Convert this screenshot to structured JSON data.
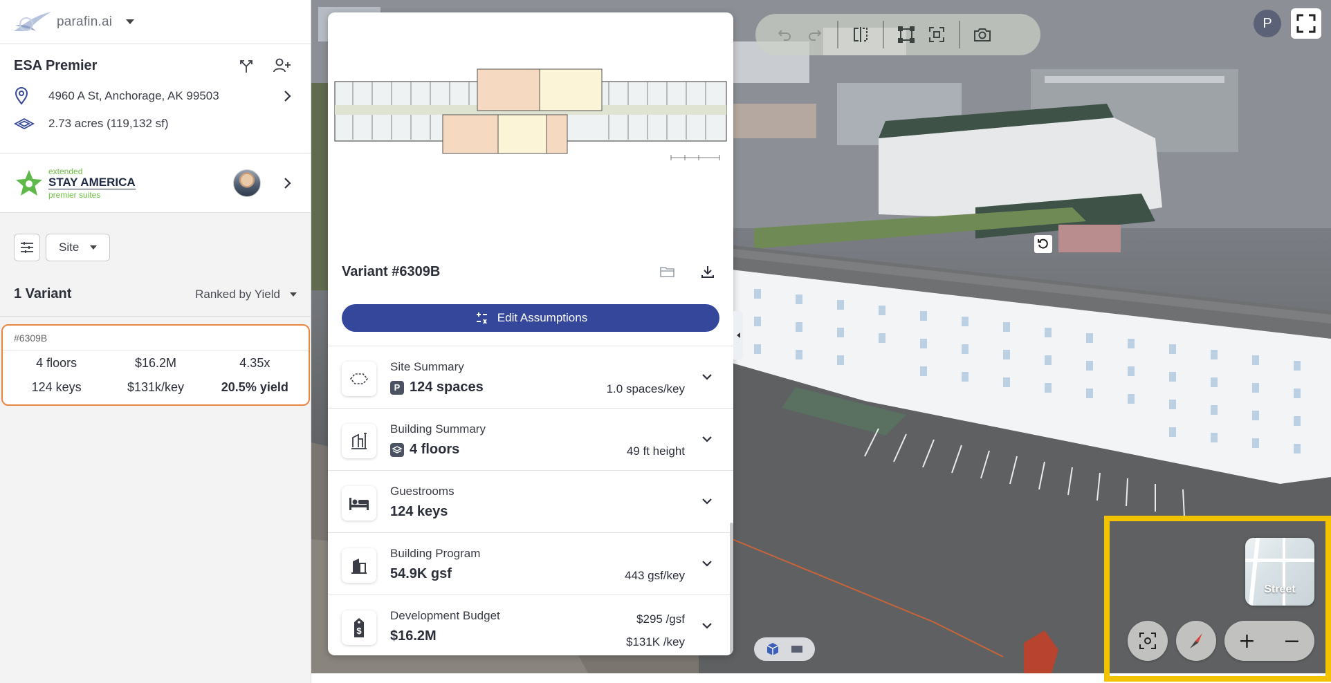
{
  "app": {
    "logo_text": "parafin.ai"
  },
  "site": {
    "name": "ESA Premier",
    "address": "4960 A St, Anchorage, AK 99503",
    "area": "2.73 acres (119,132 sf)"
  },
  "brand": {
    "line1": "extended",
    "line2": "STAY AMERICA",
    "line3": "premier suites"
  },
  "filters": {
    "site_label": "Site"
  },
  "variants": {
    "count_label": "1 Variant",
    "rank_label": "Ranked by Yield",
    "items": [
      {
        "id": "#6309B",
        "floors": "4 floors",
        "cost": "$16.2M",
        "multiple": "4.35x",
        "keys": "124 keys",
        "per_key": "$131k/key",
        "yield": "20.5% yield"
      }
    ]
  },
  "panel": {
    "title": "Variant #6309B",
    "edit_label": "Edit Assumptions",
    "sections": [
      {
        "title": "Site Summary",
        "main": "124 spaces",
        "right": "1.0 spaces/key",
        "badge": "P"
      },
      {
        "title": "Building Summary",
        "main": "4 floors",
        "right": "49 ft height"
      },
      {
        "title": "Guestrooms",
        "main": "124 keys"
      },
      {
        "title": "Building Program",
        "main": "54.9K gsf",
        "right": "443 gsf/key"
      },
      {
        "title": "Development Budget",
        "main": "$16.2M",
        "right1": "$295 /gsf",
        "right2": "$131K /key"
      }
    ]
  },
  "user": {
    "initial": "P"
  },
  "map_controls": {
    "street_label": "Street",
    "zoom_in": "+",
    "zoom_out": "−"
  },
  "colors": {
    "accent": "#34479a",
    "selected_border": "#e8863f",
    "highlight": "#f2c300"
  }
}
